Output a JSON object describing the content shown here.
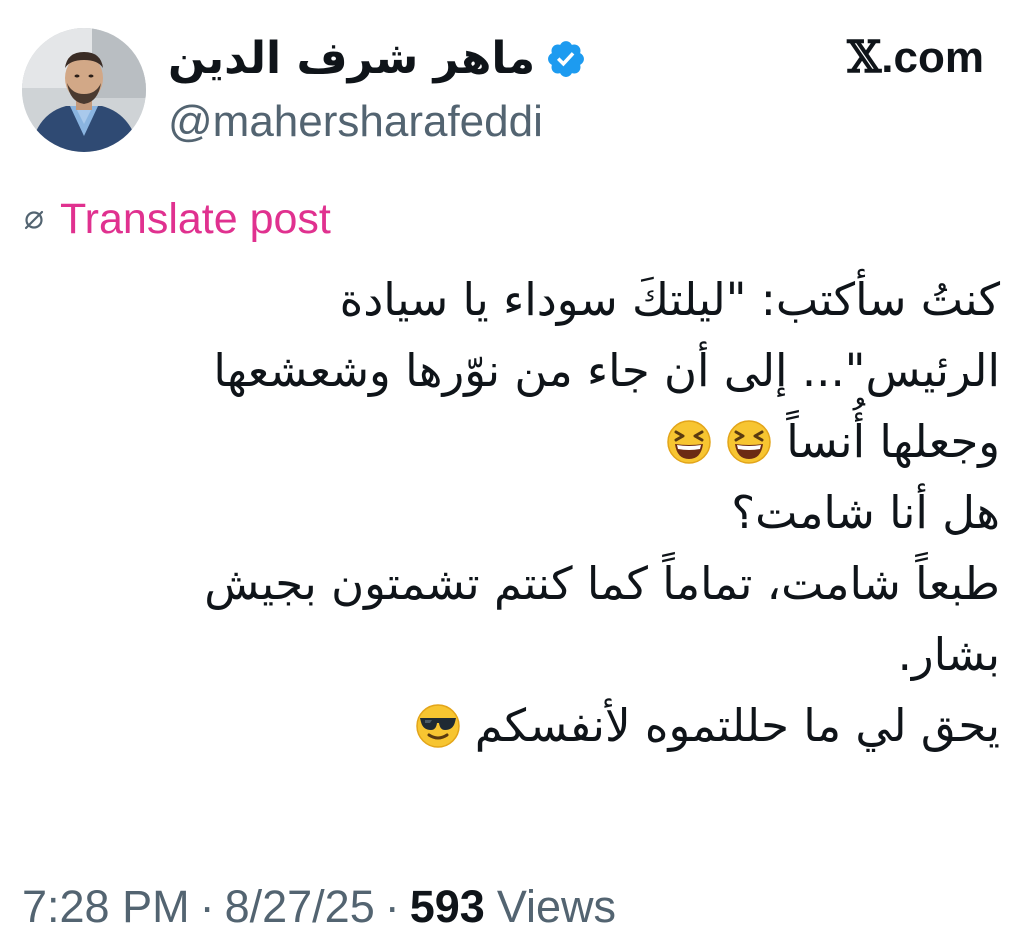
{
  "author": {
    "display_name": "ماهر شرف الدين",
    "handle": "@mahersharafeddi",
    "verified": true,
    "verified_color": "#1d9bf0"
  },
  "site": {
    "label_mark": "𝕏",
    "label_domain": ".com"
  },
  "translate": {
    "label": "Translate post",
    "color": "#e0318f",
    "icon": "globe-slash-icon"
  },
  "post": {
    "lines": [
      {
        "text": "كنتُ سأكتب: \"ليلتكَ سوداء يا سيادة"
      },
      {
        "text": "الرئيس\"... إلى أن جاء من نوّرها وشعشعها"
      },
      {
        "text": "وجعلها أُنساً",
        "emoji": "grinning-squinting-face-icon",
        "emoji_count": 2
      },
      {
        "text": "هل أنا شامت؟"
      },
      {
        "text": "طبعاً شامت، تماماً كما كنتم تشمتون بجيش"
      },
      {
        "text": "بشار."
      },
      {
        "text": "يحق لي ما حللتموه لأنفسكم",
        "emoji": "smiling-face-with-sunglasses-icon",
        "emoji_count": 1
      }
    ]
  },
  "meta": {
    "time": "7:28 PM",
    "separator": "·",
    "date": "8/27/25",
    "views_count": "593",
    "views_label": "Views"
  }
}
